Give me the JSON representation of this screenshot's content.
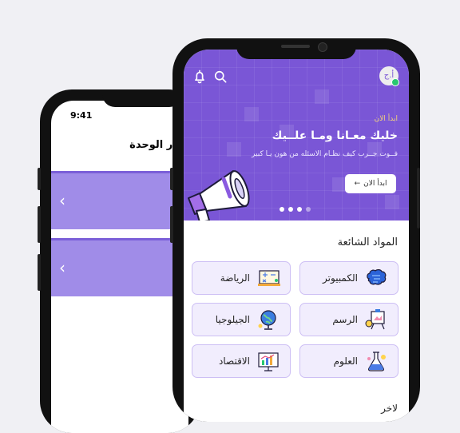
{
  "back_phone": {
    "time": "9:41",
    "title": "تار الوحدة",
    "unit_cards": [
      {
        "chevron": "chevron-left-icon"
      },
      {
        "chevron": "chevron-left-icon"
      }
    ]
  },
  "header": {
    "avatar_initials": "أ.ج",
    "notifications_icon": "bell-icon",
    "search_icon": "search-icon"
  },
  "banner": {
    "kicker": "ابدأ الان",
    "headline": "خليك معـانا ومـا علــيك",
    "subline": "فــوت جــرب كيف نظـام الاسئله من هون يـا كبير",
    "cta_label": "ابدأ الان",
    "slides_total": 4,
    "active_slide": 4
  },
  "popular": {
    "title": "المواد الشائعة",
    "subjects": [
      {
        "label": "الكمبيوتر",
        "icon": "brain-chip-icon"
      },
      {
        "label": "الرياضة",
        "icon": "math-board-icon"
      },
      {
        "label": "الرسم",
        "icon": "easel-icon"
      },
      {
        "label": "الجيلوجيا",
        "icon": "globe-icon"
      },
      {
        "label": "العلوم",
        "icon": "flask-icon"
      },
      {
        "label": "الاقتصاد",
        "icon": "chart-board-icon"
      }
    ]
  },
  "next_section_peek": "لاخر",
  "colors": {
    "brand": "#7a56d6",
    "card_bg": "#f1edfd",
    "card_border": "#cdbff4",
    "accent": "#f3d27a"
  }
}
